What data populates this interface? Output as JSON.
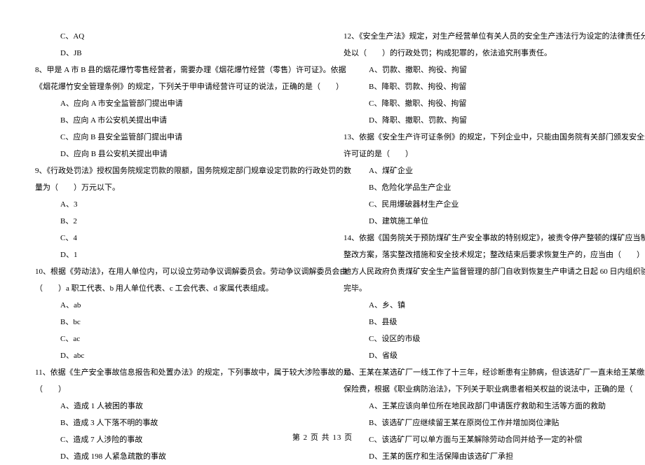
{
  "leftColumn": {
    "lines": [
      {
        "cls": "indent-2",
        "text": "C、AQ"
      },
      {
        "cls": "indent-2",
        "text": "D、JB"
      },
      {
        "cls": "question-start",
        "text": "8、甲是 A 市 B 县的烟花爆竹零售经营者，需要办理《烟花爆竹经营（零售）许可证》。依据"
      },
      {
        "cls": "question-start",
        "text": "《烟花爆竹安全管理条例》的规定，下列关于甲申请经营许可证的说法，正确的是（　　）"
      },
      {
        "cls": "indent-2",
        "text": "A、应向 A 市安全监管部门提出申请"
      },
      {
        "cls": "indent-2",
        "text": "B、应向 A 市公安机关提出申请"
      },
      {
        "cls": "indent-2",
        "text": "C、应向 B 县安全监管部门提出申请"
      },
      {
        "cls": "indent-2",
        "text": "D、应向 B 县公安机关提出申请"
      },
      {
        "cls": "question-start",
        "text": "9、《行政处罚法》授权国务院规定罚款的限额，国务院规定部门规章设定罚款的行政处罚的数"
      },
      {
        "cls": "question-start",
        "text": "量为（　　）万元以下。"
      },
      {
        "cls": "indent-2",
        "text": "A、3"
      },
      {
        "cls": "indent-2",
        "text": "B、2"
      },
      {
        "cls": "indent-2",
        "text": "C、4"
      },
      {
        "cls": "indent-2",
        "text": "D、1"
      },
      {
        "cls": "question-start",
        "text": "10、根据《劳动法》，在用人单位内，可以设立劳动争议调解委员会。劳动争议调解委员会由"
      },
      {
        "cls": "question-start",
        "text": "（　　）a 职工代表、b 用人单位代表、c 工会代表、d 家属代表组成。"
      },
      {
        "cls": "indent-2",
        "text": "A、ab"
      },
      {
        "cls": "indent-2",
        "text": "B、bc"
      },
      {
        "cls": "indent-2",
        "text": "C、ac"
      },
      {
        "cls": "indent-2",
        "text": "D、abc"
      },
      {
        "cls": "question-start",
        "text": "11、依据《生产安全事故信息报告和处置办法》的规定，下列事故中，属于较大涉险事故的是"
      },
      {
        "cls": "question-start",
        "text": "（　　）"
      },
      {
        "cls": "indent-2",
        "text": "A、造成 1 人被困的事故"
      },
      {
        "cls": "indent-2",
        "text": "B、造成 3 人下落不明的事故"
      },
      {
        "cls": "indent-2",
        "text": "C、造成 7 人涉险的事故"
      },
      {
        "cls": "indent-2",
        "text": "D、造成 198 人紧急疏散的事故"
      }
    ]
  },
  "rightColumn": {
    "lines": [
      {
        "cls": "question-start",
        "text": "12、《安全生产法》规定，对生产经营单位有关人员的安全生产违法行为设定的法律责任分别"
      },
      {
        "cls": "question-start",
        "text": "处以（　　）的行政处罚；构成犯罪的，依法追究刑事责任。"
      },
      {
        "cls": "indent-2",
        "text": "A、罚款、撤职、拘役、拘留"
      },
      {
        "cls": "indent-2",
        "text": "B、降职、罚款、拘役、拘留"
      },
      {
        "cls": "indent-2",
        "text": "C、降职、撤职、拘役、拘留"
      },
      {
        "cls": "indent-2",
        "text": "D、降职、撤职、罚款、拘留"
      },
      {
        "cls": "question-start",
        "text": "13、依据《安全生产许可证条例》的规定，下列企业中，只能由国务院有关部门颁发安全生产"
      },
      {
        "cls": "question-start",
        "text": "许可证的是（　　）"
      },
      {
        "cls": "indent-2",
        "text": "A、煤矿企业"
      },
      {
        "cls": "indent-2",
        "text": "B、危险化学品生产企业"
      },
      {
        "cls": "indent-2",
        "text": "C、民用爆破器材生产企业"
      },
      {
        "cls": "indent-2",
        "text": "D、建筑施工单位"
      },
      {
        "cls": "question-start",
        "text": "14、依据《国务院关于预防煤矿生产安全事故的特别规定》，被责令停产整顿的煤矿应当制定"
      },
      {
        "cls": "question-start",
        "text": "整改方案，落实整改措施和安全技术规定；整改结束后要求恢复生产的，应当由（　　）以上"
      },
      {
        "cls": "question-start",
        "text": "地方人民政府负责煤矿安全生产监督管理的部门自收到恢复生产申请之日起 60 日内组织验收"
      },
      {
        "cls": "question-start",
        "text": "完毕。"
      },
      {
        "cls": "indent-2",
        "text": "A、乡、镇"
      },
      {
        "cls": "indent-2",
        "text": "B、县级"
      },
      {
        "cls": "indent-2",
        "text": "C、设区的市级"
      },
      {
        "cls": "indent-2",
        "text": "D、省级"
      },
      {
        "cls": "question-start",
        "text": "15、王某在某选矿厂一线工作了十三年，经诊断患有尘肺病，但该选矿厂一直未给王某缴纳工伤"
      },
      {
        "cls": "question-start",
        "text": "保险费，根据《职业病防治法》，下列关于职业病患者相关权益的说法中，正确的是（　　）"
      },
      {
        "cls": "indent-2",
        "text": "A、王某应该向单位所在地民政部门申请医疗救助和生活等方面的救助"
      },
      {
        "cls": "indent-2",
        "text": "B、该选矿厂应继续留王某在原岗位工作并增加岗位津贴"
      },
      {
        "cls": "indent-2",
        "text": "C、该选矿厂可以单方面与王某解除劳动合同并给予一定的补偿"
      },
      {
        "cls": "indent-2",
        "text": "D、王某的医疗和生活保障由该选矿厂承担"
      }
    ]
  },
  "footer": {
    "text": "第 2 页 共 13 页"
  }
}
